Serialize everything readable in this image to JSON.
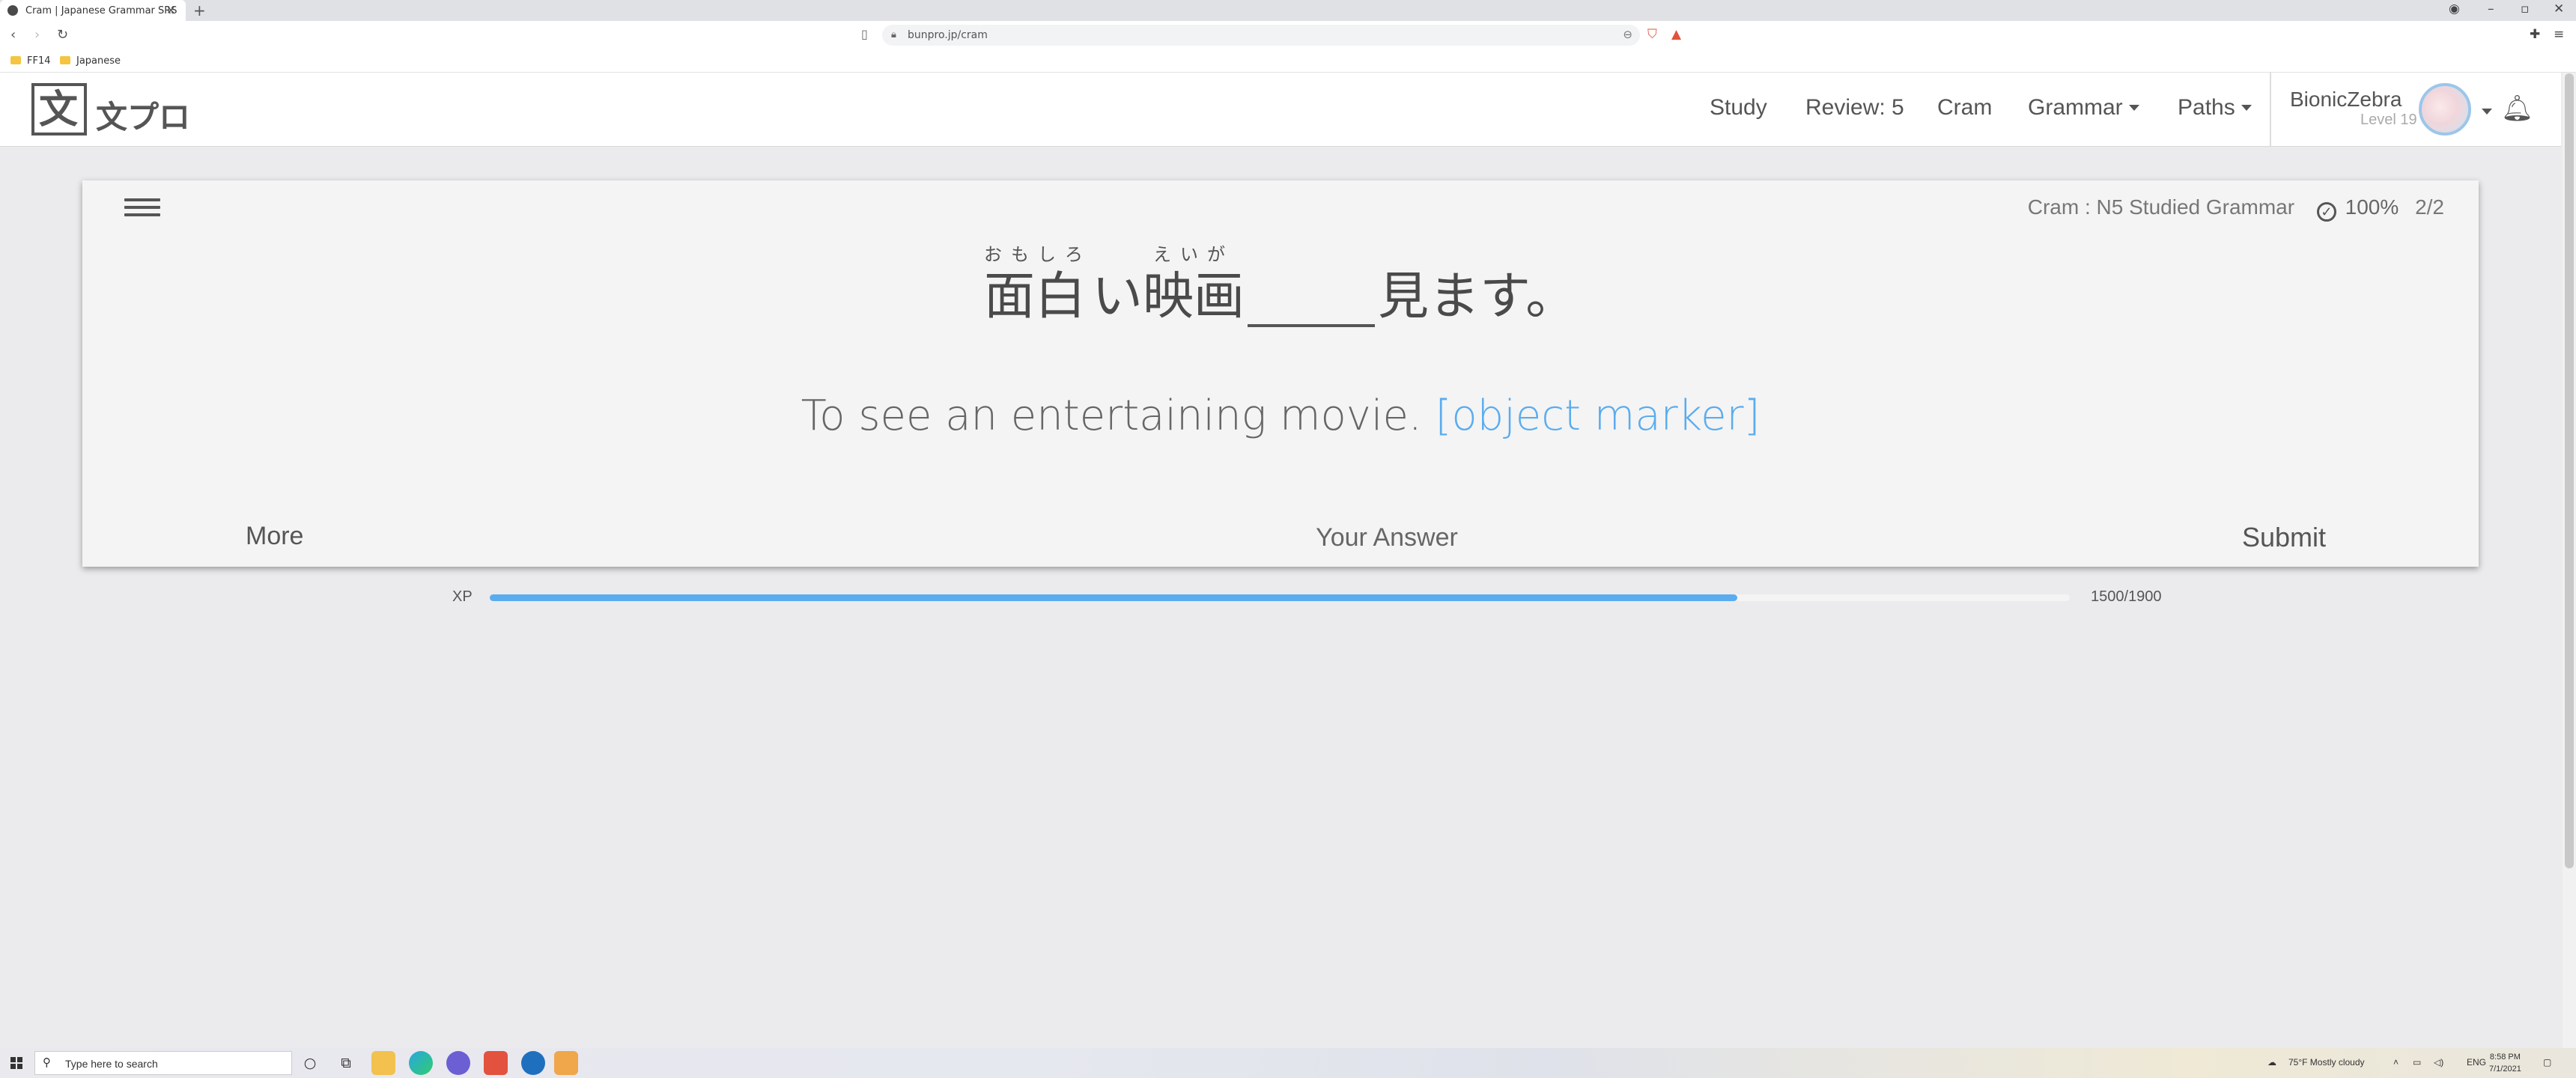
{
  "browser": {
    "tab_title": "Cram | Japanese Grammar SRS",
    "url": "bunpro.jp/cram",
    "bookmarks": [
      "FF14",
      "Japanese"
    ]
  },
  "navbar": {
    "logo_glyph": "文",
    "logo_text": "文プロ",
    "links": {
      "study": "Study",
      "review": "Review: 5",
      "cram": "Cram",
      "grammar": "Grammar",
      "paths": "Paths"
    },
    "user": {
      "name": "BionicZebra",
      "level": "Level 19"
    }
  },
  "card": {
    "mode": "Cram : N5 Studied Grammar",
    "accuracy": "100%",
    "progress": "2/2",
    "sentence": {
      "seg1_rt": "おもしろ",
      "seg1_base": "面白",
      "seg2_base": "い",
      "seg3_rt": "えいが",
      "seg3_base": "映画",
      "seg4_base": "見ます。"
    },
    "translation": "To see an entertaining movie.",
    "hint": "[object marker]",
    "more_label": "More",
    "answer_placeholder": "Your Answer",
    "submit_label": "Submit"
  },
  "xp": {
    "label": "XP",
    "current": 1500,
    "max": 1900,
    "text": "1500/1900"
  },
  "taskbar": {
    "search_placeholder": "Type here to search",
    "weather": "75°F  Mostly cloudy",
    "lang": "ENG",
    "time": "8:58 PM",
    "date": "7/1/2021"
  },
  "colors": {
    "accent_blue": "#5aacef",
    "text_gray": "#555555",
    "page_bg": "#ebebed"
  }
}
